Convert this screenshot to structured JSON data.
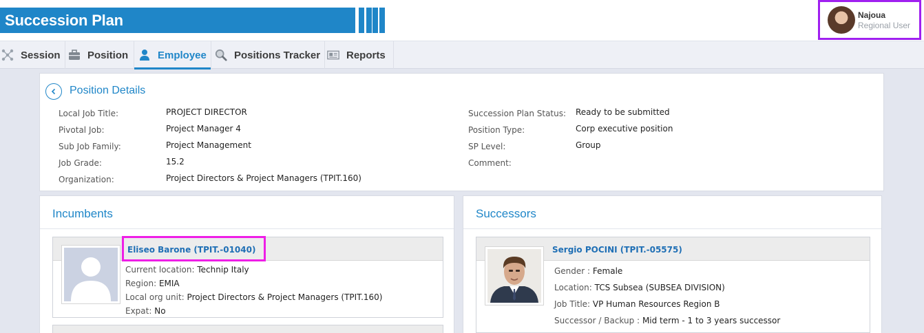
{
  "app": {
    "title": "Succession Plan"
  },
  "user": {
    "name": "Najoua",
    "role": "Regional User"
  },
  "nav": [
    {
      "label": "Session",
      "icon": "session-icon"
    },
    {
      "label": "Position",
      "icon": "briefcase-icon"
    },
    {
      "label": "Employee",
      "icon": "person-icon",
      "active": true
    },
    {
      "label": "Positions Tracker",
      "icon": "magnifier-icon"
    },
    {
      "label": "Reports",
      "icon": "reports-icon"
    }
  ],
  "details": {
    "title": "Position Details",
    "left": [
      {
        "label": "Local Job Title:",
        "value": "PROJECT DIRECTOR"
      },
      {
        "label": "Pivotal Job:",
        "value": "Project Manager 4"
      },
      {
        "label": "Sub Job Family:",
        "value": "Project Management"
      },
      {
        "label": "Job Grade:",
        "value": "15.2"
      },
      {
        "label": "Organization:",
        "value": "Project Directors & Project Managers (TPIT.160)"
      }
    ],
    "right": [
      {
        "label": "Succession Plan Status:",
        "value": "Ready to be submitted"
      },
      {
        "label": "Position Type:",
        "value": "Corp executive position"
      },
      {
        "label": "SP Level:",
        "value": "Group"
      },
      {
        "label": "Comment:",
        "value": ""
      }
    ]
  },
  "incumbents": {
    "title": "Incumbents",
    "card": {
      "name": "Eliseo Barone (TPIT.-01040)",
      "fields": [
        {
          "label": "Current location:",
          "value": "Technip Italy"
        },
        {
          "label": "Region:",
          "value": "EMIA"
        },
        {
          "label": "Local org unit:",
          "value": "Project Directors & Project Managers (TPIT.160)"
        },
        {
          "label": "Expat:",
          "value": "No"
        }
      ]
    }
  },
  "successors": {
    "title": "Successors",
    "card": {
      "name": "Sergio POCINI (TPIT.-05575)",
      "fields": [
        {
          "label": "Gender :",
          "value": "Female"
        },
        {
          "label": "Location:",
          "value": "TCS Subsea (SUBSEA DIVISION)"
        },
        {
          "label": "Job Title:",
          "value": "VP Human Resources Region B"
        },
        {
          "label": "Successor / Backup :",
          "value": "Mid term - 1 to 3 years successor"
        }
      ]
    }
  },
  "colors": {
    "brand": "#1f86c8",
    "highlight_user": "#a020f0",
    "highlight_name": "#ee1ee6"
  }
}
